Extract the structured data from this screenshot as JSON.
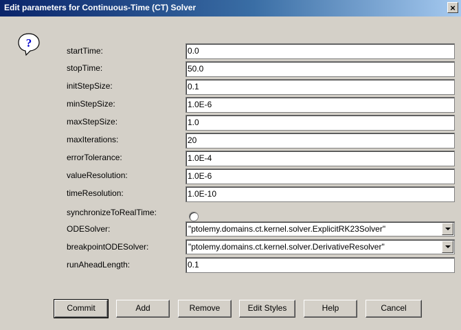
{
  "window": {
    "title": "Edit parameters for Continuous-Time (CT) Solver",
    "close_glyph": "×"
  },
  "icon": "question-icon",
  "params": [
    {
      "label": "startTime:",
      "value": "0.0"
    },
    {
      "label": "stopTime:",
      "value": "50.0"
    },
    {
      "label": "initStepSize:",
      "value": "0.1"
    },
    {
      "label": "minStepSize:",
      "value": "1.0E-6"
    },
    {
      "label": "maxStepSize:",
      "value": "1.0"
    },
    {
      "label": "maxIterations:",
      "value": "20"
    },
    {
      "label": "errorTolerance:",
      "value": "1.0E-4"
    },
    {
      "label": "valueResolution:",
      "value": "1.0E-6"
    },
    {
      "label": "timeResolution:",
      "value": "1.0E-10"
    }
  ],
  "sync": {
    "label": "synchronizeToRealTime:",
    "checked": false
  },
  "ode": {
    "label": "ODESolver:",
    "value": "\"ptolemy.domains.ct.kernel.solver.ExplicitRK23Solver\""
  },
  "breakpoint": {
    "label": "breakpointODESolver:",
    "value": "\"ptolemy.domains.ct.kernel.solver.DerivativeResolver\""
  },
  "runahead": {
    "label": "runAheadLength:",
    "value": "0.1"
  },
  "buttons": {
    "commit": "Commit",
    "add": "Add",
    "remove": "Remove",
    "edit_styles": "Edit Styles",
    "help": "Help",
    "cancel": "Cancel"
  }
}
